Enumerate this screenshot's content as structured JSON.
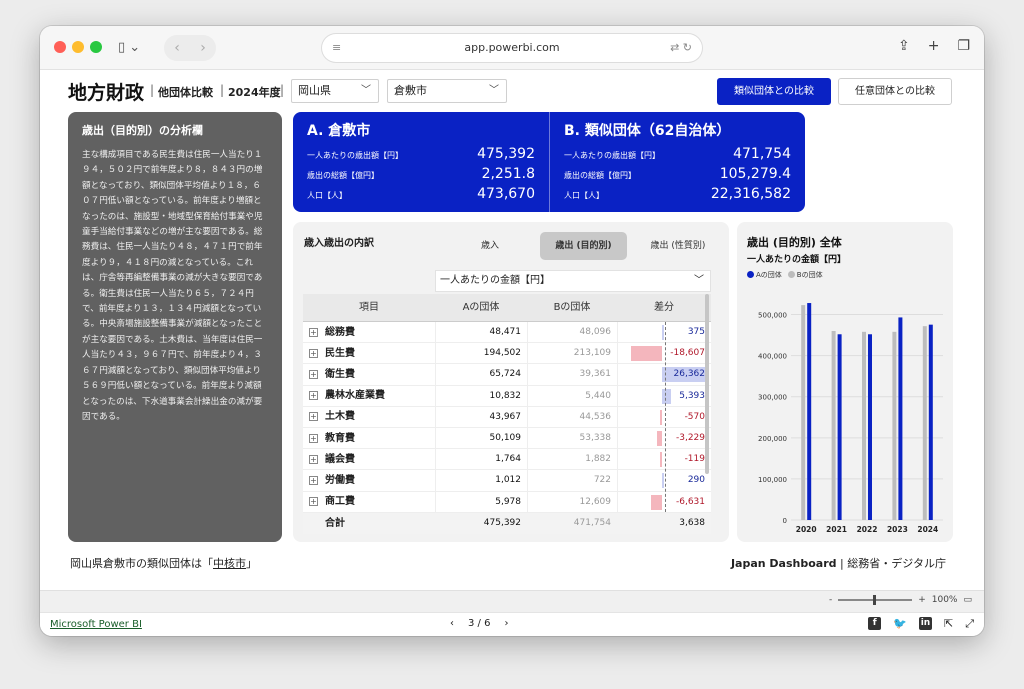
{
  "browser": {
    "url": "app.powerbi.com",
    "nav_back": "‹",
    "nav_forward": "›"
  },
  "header": {
    "title": "地方財政",
    "subtitle": "他団体比較",
    "year": "2024年度",
    "sep": "|",
    "prefecture": "岡山県",
    "city": "倉敷市",
    "btn_similar": "類似団体との比較",
    "btn_custom": "任意団体との比較"
  },
  "analysis": {
    "title": "歳出（目的別）の分析欄",
    "body": "主な構成項目である民生費は住民一人当たり１９４，５０２円で前年度より８，８４３円の増額となっており、類似団体平均値より１８，６０７円低い額となっている。前年度より増額となったのは、施設型・地域型保育給付事業や児童手当給付事業などの増が主な要因である。総務費は、住民一人当たり４８，４７１円で前年度より９，４１８円の減となっている。これは、庁舎等再編整備事業の減が大きな要因である。衛生費は住民一人当たり６５，７２４円で、前年度より１３，１３４円減額となっている。中央斎場施設整備事業が減額となったことが主な要因である。土木費は、当年度は住民一人当たり４３，９６７円で、前年度より４，３６７円減額となっており、類似団体平均値より５６９円低い額となっている。前年度より減額となったのは、下水道事業会計繰出金の減が要因である。"
  },
  "kpi": {
    "a": {
      "title": "A. 倉敷市",
      "rows": [
        {
          "label": "一人あたりの歳出額【円】",
          "value": "475,392"
        },
        {
          "label": "歳出の総額【億円】",
          "value": "2,251.8"
        },
        {
          "label": "人口【人】",
          "value": "473,670"
        }
      ]
    },
    "b": {
      "title": "B. 類似団体（62自治体）",
      "rows": [
        {
          "label": "一人あたりの歳出額【円】",
          "value": "471,754"
        },
        {
          "label": "歳出の総額【億円】",
          "value": "105,279.4"
        },
        {
          "label": "人口【人】",
          "value": "22,316,582"
        }
      ]
    }
  },
  "breakdown": {
    "title": "歳入歳出の内訳",
    "tabs": [
      "歳入",
      "歳出 (目的別)",
      "歳出 (性質別)"
    ],
    "metric": "一人あたりの金額【円】",
    "columns": [
      "項目",
      "Aの団体",
      "Bの団体",
      "差分"
    ],
    "rows": [
      {
        "item": "総務費",
        "a": "48,471",
        "b": "48,096",
        "diff": "375",
        "diff_value": 375
      },
      {
        "item": "民生費",
        "a": "194,502",
        "b": "213,109",
        "diff": "-18,607",
        "diff_value": -18607
      },
      {
        "item": "衛生費",
        "a": "65,724",
        "b": "39,361",
        "diff": "26,362",
        "diff_value": 26362
      },
      {
        "item": "農林水産業費",
        "a": "10,832",
        "b": "5,440",
        "diff": "5,393",
        "diff_value": 5393
      },
      {
        "item": "土木費",
        "a": "43,967",
        "b": "44,536",
        "diff": "-570",
        "diff_value": -570
      },
      {
        "item": "教育費",
        "a": "50,109",
        "b": "53,338",
        "diff": "-3,229",
        "diff_value": -3229
      },
      {
        "item": "議会費",
        "a": "1,764",
        "b": "1,882",
        "diff": "-119",
        "diff_value": -119
      },
      {
        "item": "労働費",
        "a": "1,012",
        "b": "722",
        "diff": "290",
        "diff_value": 290
      },
      {
        "item": "商工費",
        "a": "5,978",
        "b": "12,609",
        "diff": "-6,631",
        "diff_value": -6631
      }
    ],
    "total": {
      "item": "合計",
      "a": "475,392",
      "b": "471,754",
      "diff": "3,638"
    },
    "colors": {
      "positive": "#c9cff2",
      "negative": "#f4b6bd",
      "pos_text": "#1a2a9a",
      "neg_text": "#b0182a"
    }
  },
  "chart_data": {
    "type": "bar",
    "title": "歳出 (目的別) 全体",
    "subtitle": "一人あたりの金額【円】",
    "categories": [
      "2020",
      "2021",
      "2022",
      "2023",
      "2024"
    ],
    "series": [
      {
        "name": "Aの団体",
        "color": "#0a22c4",
        "values": [
          528000,
          452000,
          452000,
          493000,
          475392
        ]
      },
      {
        "name": "Bの団体",
        "color": "#bdbdbd",
        "values": [
          523000,
          460000,
          458000,
          458000,
          471754
        ]
      }
    ],
    "ylim": [
      0,
      550000
    ],
    "yticks": [
      0,
      100000,
      200000,
      300000,
      400000,
      500000
    ],
    "ytick_labels": [
      "0",
      "100,000",
      "200,000",
      "300,000",
      "400,000",
      "500,000"
    ],
    "grid": true,
    "legend": "top-left"
  },
  "footer": {
    "similar_prefix": "岡山県倉敷市の類似団体は「",
    "similar_link": "中核市",
    "similar_suffix": "」",
    "brand": "Japan Dashboard",
    "org": " | 総務省・デジタル庁"
  },
  "zoom": {
    "minus": "-",
    "plus": "+",
    "level": "100%"
  },
  "bottom": {
    "powerbi_link": "Microsoft Power BI",
    "page": "3 / 6",
    "prev": "‹",
    "next": "›"
  }
}
